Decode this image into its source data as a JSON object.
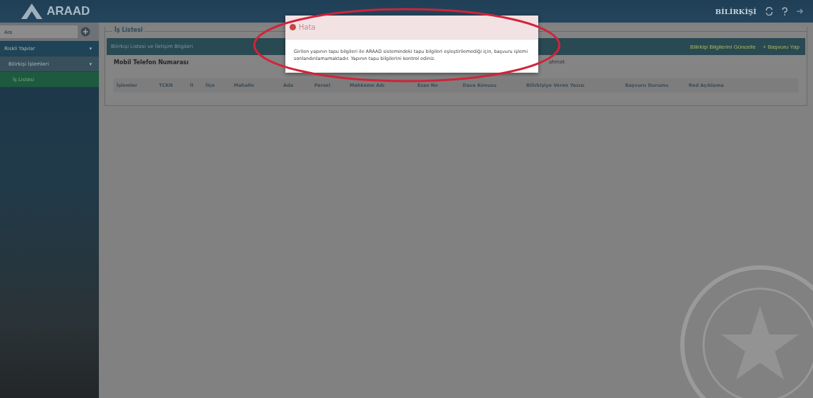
{
  "header": {
    "logo": "ARAAD",
    "user_role": "BİLİRKİŞİ"
  },
  "sidebar": {
    "search": {
      "placeholder": "Ara"
    },
    "items": [
      {
        "label": "Riskli Yapılar",
        "caret": "▾",
        "selected": false,
        "children": [
          {
            "label": "Bilirkişi İşlemleri",
            "caret": "▾",
            "selected": false,
            "children": [
              {
                "label": "İş Listesi",
                "selected": true
              }
            ]
          }
        ]
      }
    ]
  },
  "main": {
    "title": "İş Listesi",
    "panel": {
      "title": "Bilirkişi Listesi ve İletişim Bilgileri",
      "buttons": [
        "Bilirkişi Bilgilerini Güncelle",
        "+ Başvuru Yap"
      ],
      "field_label": "Mobil Telefon Numarası",
      "field_value": "ahmet"
    },
    "table": {
      "columns": [
        "İşlemler",
        "TCKN",
        "İl",
        "İlçe",
        "Mahalle",
        "Ada",
        "Parsel",
        "Mahkeme Adı",
        "Esas No",
        "Dava Konusu",
        "Bilirkişiye Veren Yazısı",
        "Başvuru Durumu",
        "Red Açıklama"
      ]
    }
  },
  "dialog": {
    "title": "Hata",
    "message": "Girilen yapının tapu bilgileri ile ARAAD sistemindeki tapu bilgileri eşleştirilemediği için, başvuru işlemi sonlandırılamamaktadır. Yapının tapu bilgilerini kontrol ediniz."
  }
}
